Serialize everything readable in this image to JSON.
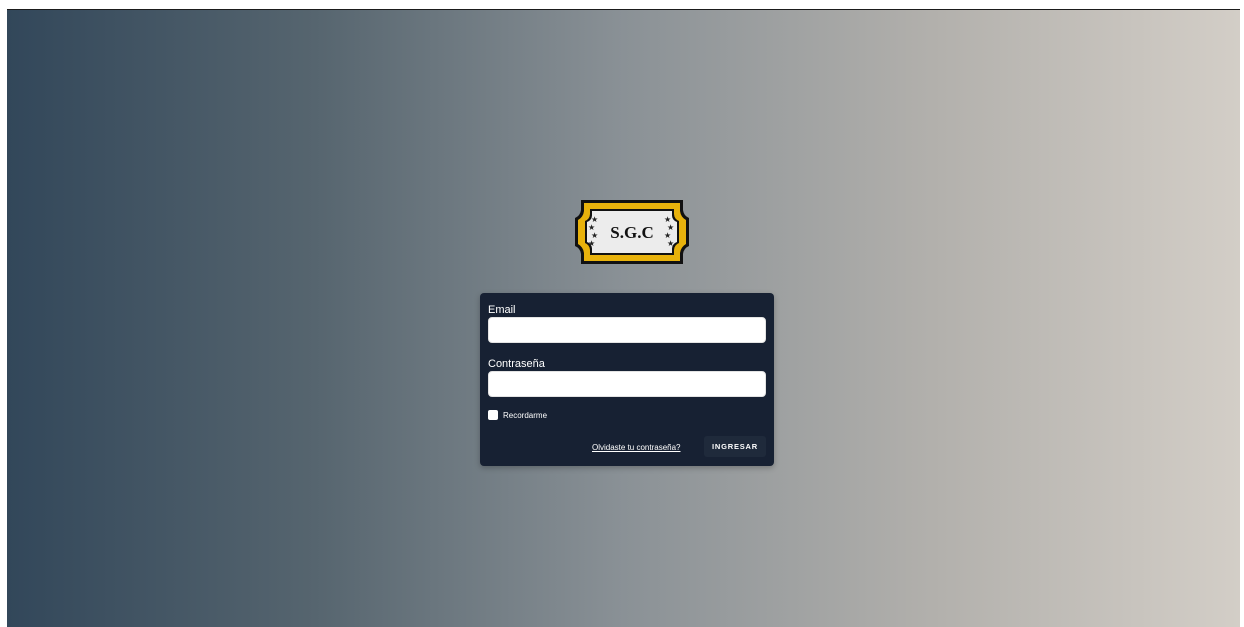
{
  "logo": {
    "text": "S.G.C",
    "frame_color": "#e8b20c",
    "border_color": "#111111",
    "inner_color": "#ececec",
    "icon": "star-emblem-icon"
  },
  "login": {
    "email_label": "Email",
    "email_value": "",
    "password_label": "Contraseña",
    "password_value": "",
    "remember_label": "Recordarme",
    "remember_checked": false,
    "forgot_link": "Olvidaste tu contraseña?",
    "submit_label": "INGRESAR"
  },
  "colors": {
    "card_background": "#172133",
    "gradient_start": "#32475a",
    "gradient_end": "#d3cec7"
  }
}
